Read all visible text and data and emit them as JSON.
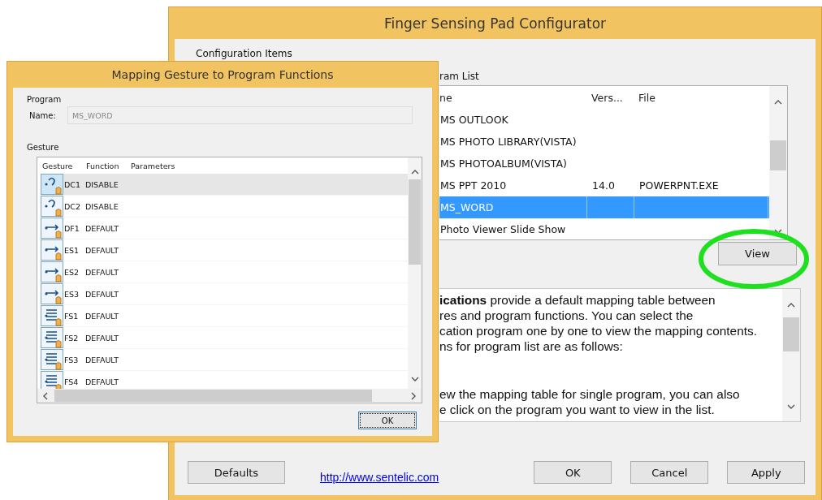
{
  "main_window": {
    "title": "Finger Sensing Pad Configurator",
    "group_label": "Configuration Items",
    "program_list": {
      "label": "ram List",
      "columns": [
        "ne",
        "Vers...",
        "File"
      ],
      "rows": [
        {
          "name": "MS OUTLOOK",
          "selected": false
        },
        {
          "name": "MS PHOTO LIBRARY(VISTA)",
          "selected": false
        },
        {
          "name": "MS PHOTOALBUM(VISTA)",
          "selected": false
        },
        {
          "name": "MS PPT 2010",
          "version": "14.0",
          "file": "POWERPNT.EXE",
          "selected": false
        },
        {
          "name": "MS_WORD",
          "selected": true
        },
        {
          "name": "Photo Viewer Slide Show",
          "selected": false
        }
      ]
    },
    "view_button": "View",
    "description": {
      "paragraphs": [
        {
          "lines": [
            "**ications** provide a default mapping table between",
            "res and program functions. You can select the",
            "cation program one by one to view the mapping contents.",
            "ns for program list are as follows:"
          ]
        },
        {
          "lines": [
            "ew the mapping table for single program, you can also",
            "e click on the program you want to view in the list."
          ]
        }
      ]
    },
    "defaults_button": "Defaults",
    "link": "http://www.sentelic.com",
    "buttons": [
      "OK",
      "Cancel",
      "Apply"
    ]
  },
  "dialog": {
    "title": "Mapping Gesture to Program Functions",
    "program_group": "Program",
    "name_label": "Name:",
    "name_value": "MS_WORD",
    "gesture_group": "Gesture",
    "columns": [
      "Gesture",
      "Function",
      "Parameters"
    ],
    "rows": [
      {
        "gesture": "DC1",
        "function": "DISABLE",
        "selected": true
      },
      {
        "gesture": "DC2",
        "function": "DISABLE",
        "selected": false
      },
      {
        "gesture": "DF1",
        "function": "DEFAULT",
        "selected": false
      },
      {
        "gesture": "ES1",
        "function": "DEFAULT",
        "selected": false
      },
      {
        "gesture": "ES2",
        "function": "DEFAULT",
        "selected": false
      },
      {
        "gesture": "ES3",
        "function": "DEFAULT",
        "selected": false
      },
      {
        "gesture": "FS1",
        "function": "DEFAULT",
        "selected": false
      },
      {
        "gesture": "FS2",
        "function": "DEFAULT",
        "selected": false
      },
      {
        "gesture": "FS3",
        "function": "DEFAULT",
        "selected": false
      },
      {
        "gesture": "FS4",
        "function": "DEFAULT",
        "selected": false
      }
    ],
    "ok_button": "OK"
  }
}
